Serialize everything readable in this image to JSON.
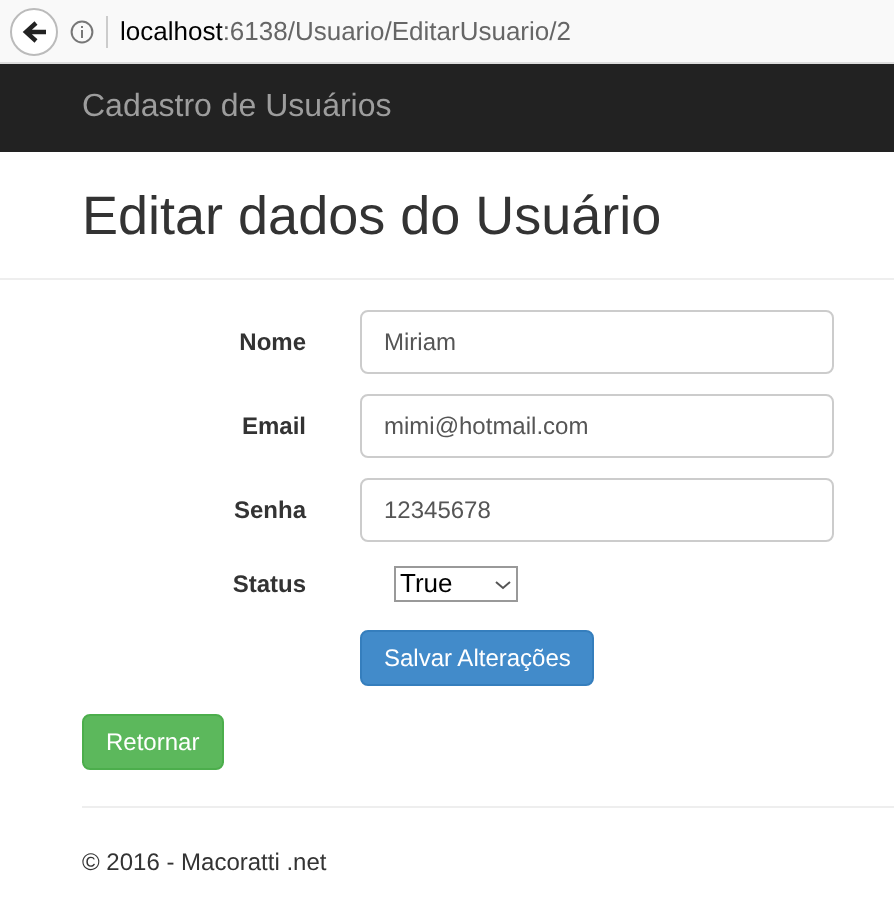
{
  "browser": {
    "url": "**localhost**:6138/Usuario/EditarUsuario/2"
  },
  "navbar": {
    "brand": "Cadastro de Usuários"
  },
  "heading": "Editar dados do Usuário",
  "fields": [
    {
      "label": "Nome",
      "value": "Miriam"
    },
    {
      "label": "Email",
      "value": "mimi@hotmail.com"
    },
    {
      "label": "Senha",
      "value": "12345678"
    }
  ],
  "status": {
    "label": "Status",
    "value": "True"
  },
  "save_button": "Salvar Alterações",
  "back_button": "Retornar",
  "footer": "© 2016 - Macoratti .net"
}
